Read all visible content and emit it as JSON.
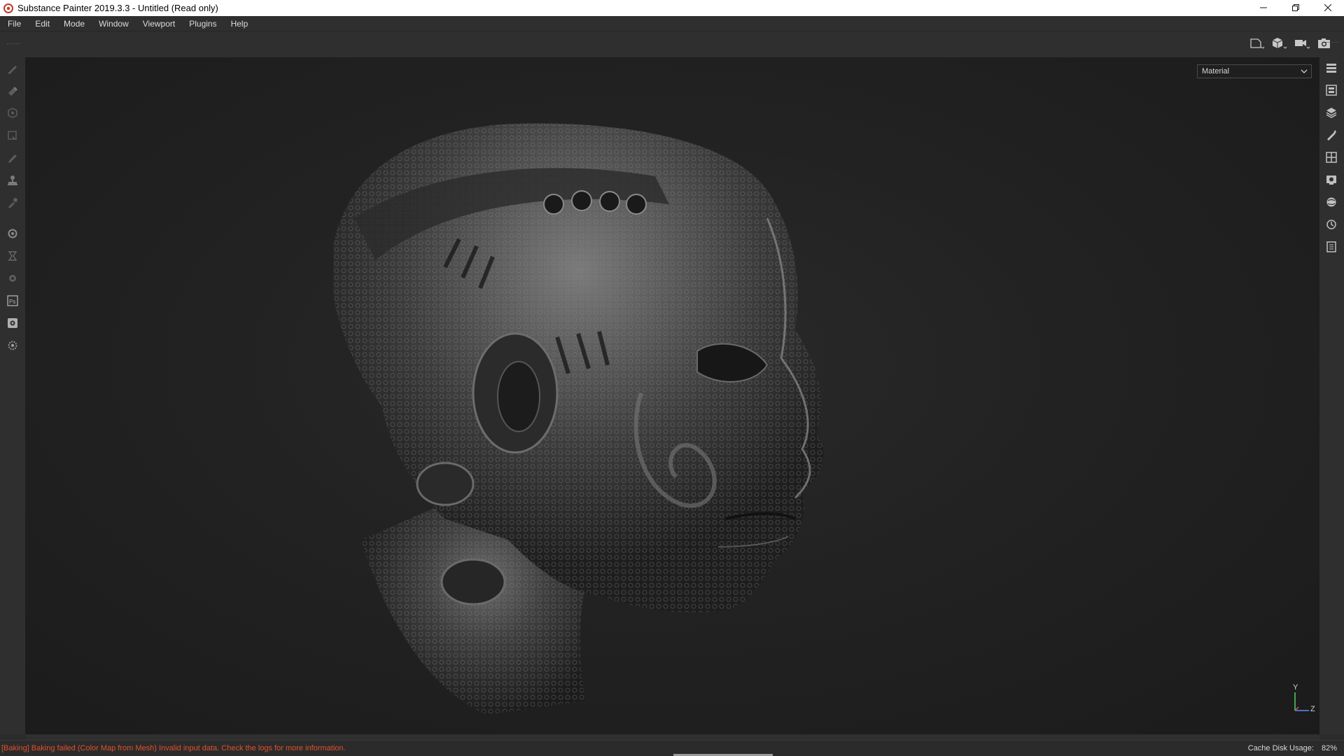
{
  "window": {
    "title": "Substance Painter 2019.3.3 - Untitled (Read only)",
    "app_icon": "substance-painter-logo",
    "controls": [
      "minimize-icon",
      "restore-icon",
      "close-icon"
    ]
  },
  "menu": {
    "items": [
      "File",
      "Edit",
      "Mode",
      "Window",
      "Viewport",
      "Plugins",
      "Help"
    ]
  },
  "viewport_toolbar": {
    "tools": [
      "3d-2d-view-icon",
      "object-view-icon",
      "camera-icon",
      "screenshot-icon"
    ]
  },
  "left_tools": {
    "items": [
      "paint-brush-icon",
      "eraser-icon",
      "projection-icon",
      "polygon-fill-icon",
      "smudge-icon",
      "clone-stamp-icon",
      "color-picker-icon",
      "bake-icon",
      "geometry-mask-icon",
      "resource-updater-icon",
      "photoshop-export-icon",
      "sketchfab-icon",
      "plugin-settings-icon"
    ]
  },
  "right_tools": {
    "items": [
      "texture-set-list-icon",
      "texture-set-settings-icon",
      "layers-icon",
      "properties-icon",
      "display-settings-icon",
      "viewer-settings-icon",
      "environment-icon",
      "history-icon",
      "log-icon"
    ]
  },
  "viewport": {
    "display_mode": "Material",
    "subject": "sculpted-head-model",
    "axis": {
      "up": "Y",
      "right": "Z"
    }
  },
  "status": {
    "error": "[Baking] Baking failed (Color Map from Mesh) Invalid input data. Check the logs for more information.",
    "cache_label": "Cache Disk Usage:",
    "cache_value": "82%"
  },
  "colors": {
    "panel": "#2f2f2f",
    "viewport_bg": "#222222",
    "error_text": "#e0502a",
    "icon": "#b8b8b8"
  }
}
